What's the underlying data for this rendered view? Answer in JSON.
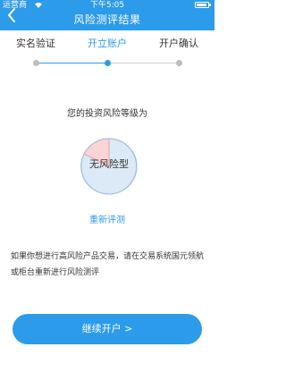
{
  "status_bar": {
    "carrier": "运营商",
    "time": "下午5:05",
    "battery_level": 0.9
  },
  "header": {
    "title": "风险测评结果",
    "back_icon": "chevron-left-icon"
  },
  "steps": [
    {
      "label": "实名验证",
      "state": "done"
    },
    {
      "label": "开立账户",
      "state": "current"
    },
    {
      "label": "开户确认",
      "state": "pending"
    }
  ],
  "result": {
    "heading": "您的投资风险等级为",
    "risk_level": "无风险型",
    "retest_label": "重新评测"
  },
  "notice": "如果你想进行高风险产品交易，请在交易系统国元领航或柜台重新进行风险测评",
  "continue_button": "继续开户 >",
  "colors": {
    "accent": "#2c9bea",
    "risk_blue": "#dce9f6",
    "risk_red": "#f9d5d5",
    "inactive_dot": "#bdbdbd"
  }
}
